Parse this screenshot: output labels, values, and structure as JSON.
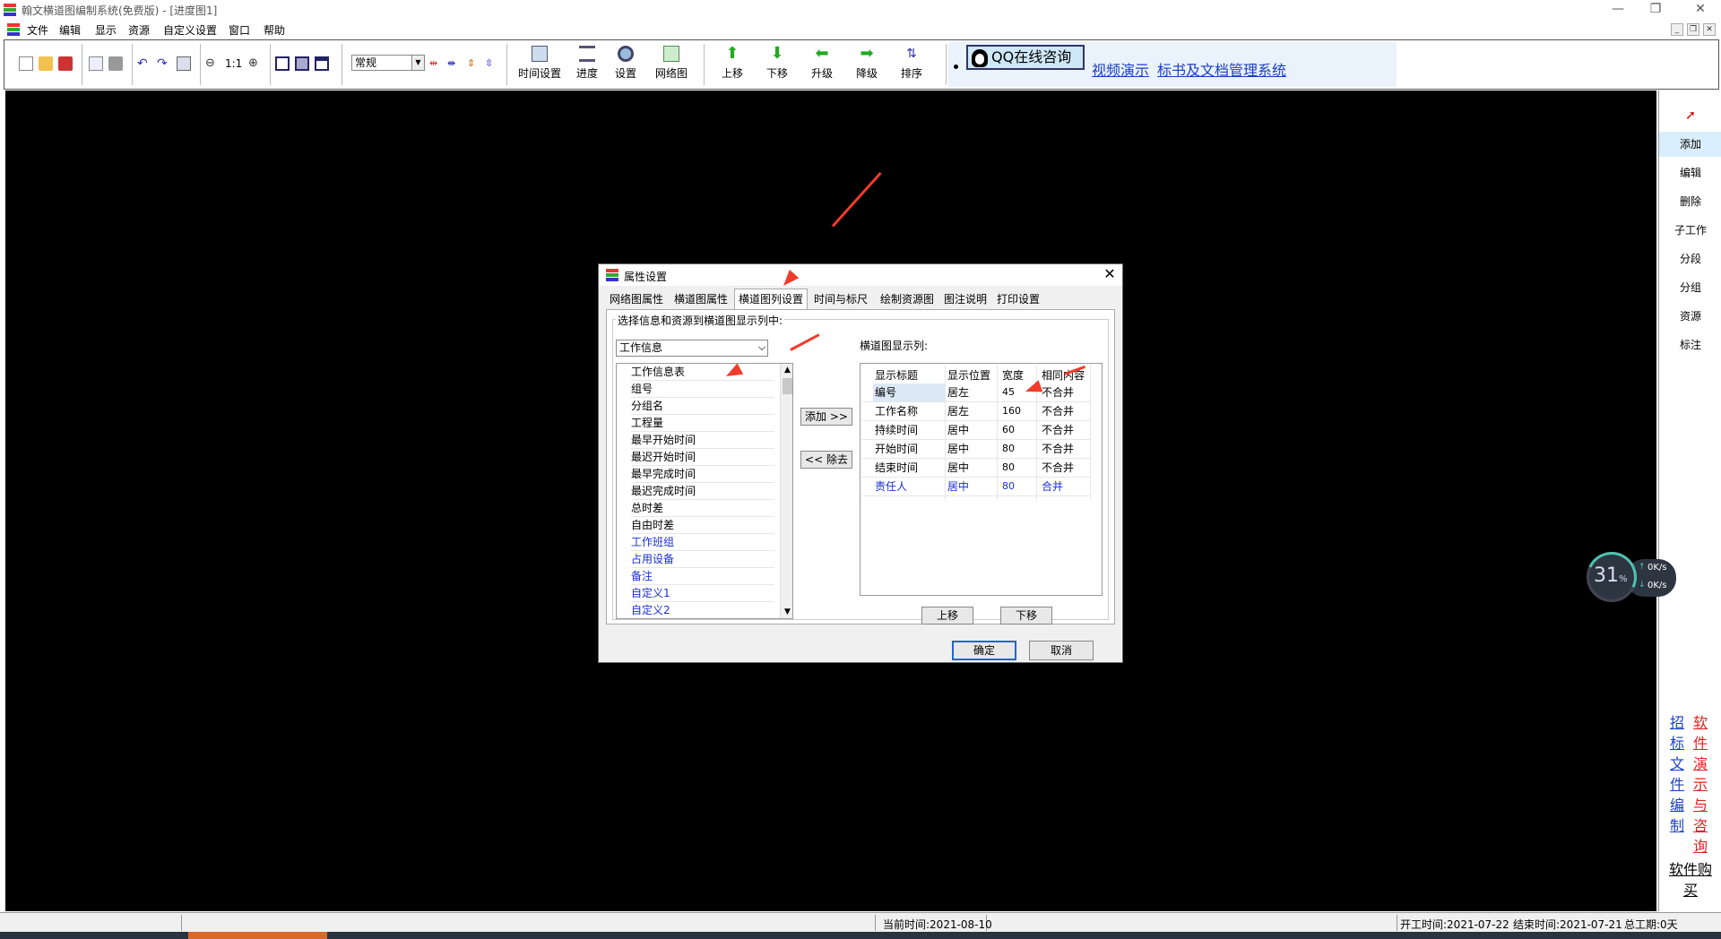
{
  "window": {
    "title": "翰文横道图编制系统(免费版) - [进度图1]"
  },
  "menu": {
    "items": [
      "文件",
      "编辑",
      "显示",
      "资源",
      "自定义设置",
      "窗口",
      "帮助"
    ]
  },
  "toolbar": {
    "view_combo_value": "常规",
    "zoom_label": "1:1",
    "big_buttons": [
      "时间设置",
      "进度",
      "设置",
      "网络图"
    ],
    "move_buttons": [
      "上移",
      "下移",
      "升级",
      "降级",
      "排序"
    ]
  },
  "ad_panel": {
    "qq_button": "QQ在线咨询",
    "video_link": "视频演示",
    "doc_link": "标书及文档管理系统"
  },
  "right_panel": {
    "items": [
      "添加",
      "编辑",
      "删除",
      "子工作",
      "分段",
      "分组",
      "资源",
      "标注"
    ],
    "link_blue": "招标文件编制",
    "link_red": "软件演示与咨询",
    "link_buy": "软件购买"
  },
  "speed_widget": {
    "percent": "31",
    "unit": "%",
    "upload": "0K/s",
    "download": "0K/s"
  },
  "dialog": {
    "title": "属性设置",
    "tabs": [
      "网络图属性",
      "横道图属性",
      "横道图列设置",
      "时间与标尺",
      "绘制资源图",
      "图注说明",
      "打印设置"
    ],
    "active_tab": "横道图列设置",
    "group_label": "选择信息和资源到横道图显示列中:",
    "source_select": "工作信息",
    "source_items": [
      {
        "label": "工作信息表",
        "blue": false
      },
      {
        "label": "组号",
        "blue": false
      },
      {
        "label": "分组名",
        "blue": false
      },
      {
        "label": "工程量",
        "blue": false
      },
      {
        "label": "最早开始时间",
        "blue": false
      },
      {
        "label": "最迟开始时间",
        "blue": false
      },
      {
        "label": "最早完成时间",
        "blue": false
      },
      {
        "label": "最迟完成时间",
        "blue": false
      },
      {
        "label": "总时差",
        "blue": false
      },
      {
        "label": "自由时差",
        "blue": false
      },
      {
        "label": "工作班组",
        "blue": true
      },
      {
        "label": "占用设备",
        "blue": true
      },
      {
        "label": "备注",
        "blue": true
      },
      {
        "label": "自定义1",
        "blue": true
      },
      {
        "label": "自定义2",
        "blue": true
      }
    ],
    "add_button": "添加 >>",
    "remove_button": "<< 除去",
    "display_label": "横道图显示列:",
    "grid_headers": [
      "显示标题",
      "显示位置",
      "宽度",
      "相同内容"
    ],
    "grid_rows": [
      {
        "title": "编号",
        "position": "居左",
        "width": "45",
        "same": "不合并",
        "blue": false
      },
      {
        "title": "工作名称",
        "position": "居左",
        "width": "160",
        "same": "不合并",
        "blue": false
      },
      {
        "title": "持续时间",
        "position": "居中",
        "width": "60",
        "same": "不合并",
        "blue": false
      },
      {
        "title": "开始时间",
        "position": "居中",
        "width": "80",
        "same": "不合并",
        "blue": false
      },
      {
        "title": "结束时间",
        "position": "居中",
        "width": "80",
        "same": "不合并",
        "blue": false
      },
      {
        "title": "责任人",
        "position": "居中",
        "width": "80",
        "same": "合并",
        "blue": true
      }
    ],
    "up_button": "上移",
    "down_button": "下移",
    "ok_button": "确定",
    "cancel_button": "取消"
  },
  "status": {
    "current_time": "当前时间:2021-08-10",
    "start_time": "开工时间:2021-07-22",
    "end_time": "结束时间:2021-07-21",
    "total_duration": "总工期:0天"
  },
  "colors": {
    "canvas": "#000000",
    "arrow": "#f23b2a",
    "link_blue": "#1a3fc4",
    "link_red": "#e02020",
    "list_blue": "#1a2fd6"
  }
}
